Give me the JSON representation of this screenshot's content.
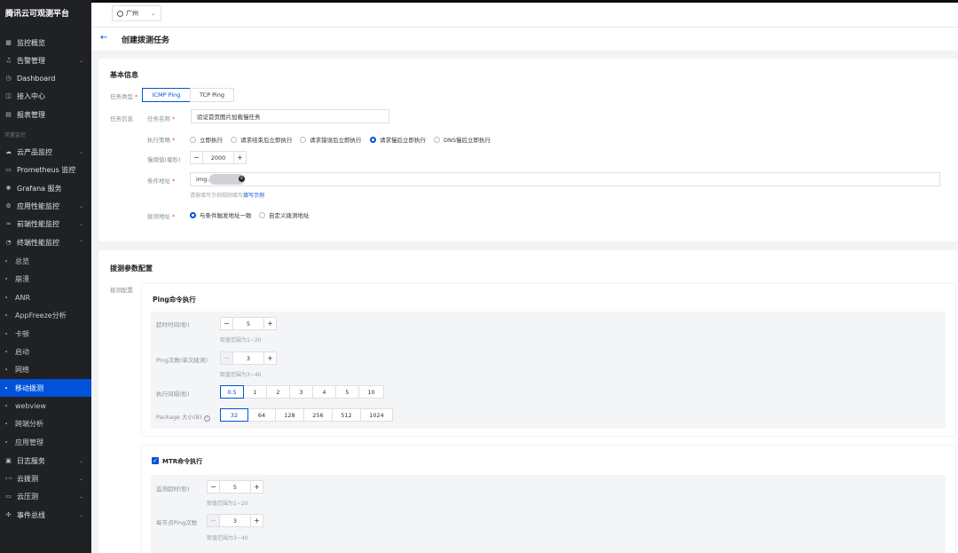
{
  "app": {
    "title": "腾讯云可观测平台"
  },
  "sidebar": {
    "group_label": "常量监控",
    "items": [
      {
        "label": "监控概览",
        "icon": "grid-icon",
        "chevron": false
      },
      {
        "label": "告警管理",
        "icon": "bell-icon",
        "chevron": true
      },
      {
        "label": "Dashboard",
        "icon": "dashboard-icon",
        "chevron": false
      },
      {
        "label": "接入中心",
        "icon": "plug-icon",
        "chevron": false
      },
      {
        "label": "报表管理",
        "icon": "report-icon",
        "chevron": false
      }
    ],
    "items2": [
      {
        "label": "云产品监控",
        "icon": "cloud-icon",
        "chevron": true
      },
      {
        "label": "Prometheus 监控",
        "icon": "prometheus-icon",
        "chevron": false
      },
      {
        "label": "Grafana 服务",
        "icon": "grafana-icon",
        "chevron": false
      },
      {
        "label": "应用性能监控",
        "icon": "apm-icon",
        "chevron": true
      },
      {
        "label": "前端性能监控",
        "icon": "frontend-icon",
        "chevron": true
      },
      {
        "label": "终端性能监控",
        "icon": "terminal-icon",
        "chevron": true
      }
    ],
    "subitems": [
      {
        "label": "总览"
      },
      {
        "label": "崩溃"
      },
      {
        "label": "ANR"
      },
      {
        "label": "AppFreeze分析"
      },
      {
        "label": "卡顿"
      },
      {
        "label": "启动"
      },
      {
        "label": "网络"
      },
      {
        "label": "移动拨测",
        "active": true
      },
      {
        "label": "webview"
      },
      {
        "label": "跨端分析"
      },
      {
        "label": "应用管理"
      }
    ],
    "items3": [
      {
        "label": "日志服务",
        "icon": "log-icon",
        "chevron": true
      },
      {
        "label": "云拨测",
        "icon": "dial-icon",
        "chevron": true
      },
      {
        "label": "云压测",
        "icon": "loadtest-icon",
        "chevron": true
      },
      {
        "label": "事件总线",
        "icon": "eventbus-icon",
        "chevron": true
      }
    ]
  },
  "topbar": {
    "region": "广州"
  },
  "page": {
    "title": "创建拨测任务"
  },
  "basic": {
    "section_title": "基本信息",
    "task_type_label": "任务类型",
    "task_types": [
      "ICMP Ping",
      "TCP Ping"
    ],
    "task_info_label": "任务信息",
    "task_name_label": "任务名称",
    "task_name_value": "验证首页图片加载慢任务",
    "strategy_label": "执行策略",
    "strategies": [
      "立即执行",
      "请求结束后立即执行",
      "请求错误后立即执行",
      "请求慢后立即执行",
      "DNS慢后立即执行"
    ],
    "strategy_selected": 3,
    "slow_threshold_label": "慢阈值(毫秒)",
    "slow_threshold_value": "2000",
    "cond_addr_label": "条件地址",
    "cond_addr_value": "img.a",
    "cond_hint": "请按填写示例规则填写",
    "cond_hint_link": "填写示例",
    "probe_addr_label": "拨测地址",
    "probe_options": [
      "与条件触发地址一致",
      "自定义拨测地址"
    ],
    "probe_selected": 0
  },
  "params": {
    "section_title": "拨测参数配置",
    "config_label": "拨测配置",
    "ping": {
      "title": "Ping命令执行",
      "timeout_label": "超时时间(秒)",
      "timeout_value": "5",
      "timeout_hint": "取值范围为1~20",
      "count_label": "Ping次数(单次拨测)",
      "count_value": "3",
      "count_hint": "取值范围为3~40",
      "interval_label": "执行间隔(秒)",
      "interval_options": [
        "0.5",
        "1",
        "2",
        "3",
        "4",
        "5",
        "10"
      ],
      "interval_selected": 0,
      "package_label": "Package 大小(B)",
      "package_options": [
        "32",
        "64",
        "128",
        "256",
        "512",
        "1024"
      ],
      "package_selected": 0
    },
    "mtr": {
      "title": "MTR命令执行",
      "checked": true,
      "timeout_label": "监测超时(秒)",
      "timeout_value": "5",
      "timeout_hint": "取值范围为1~20",
      "count_label": "每节点Ping次数",
      "count_value": "3",
      "count_hint": "取值范围为3~40"
    }
  }
}
